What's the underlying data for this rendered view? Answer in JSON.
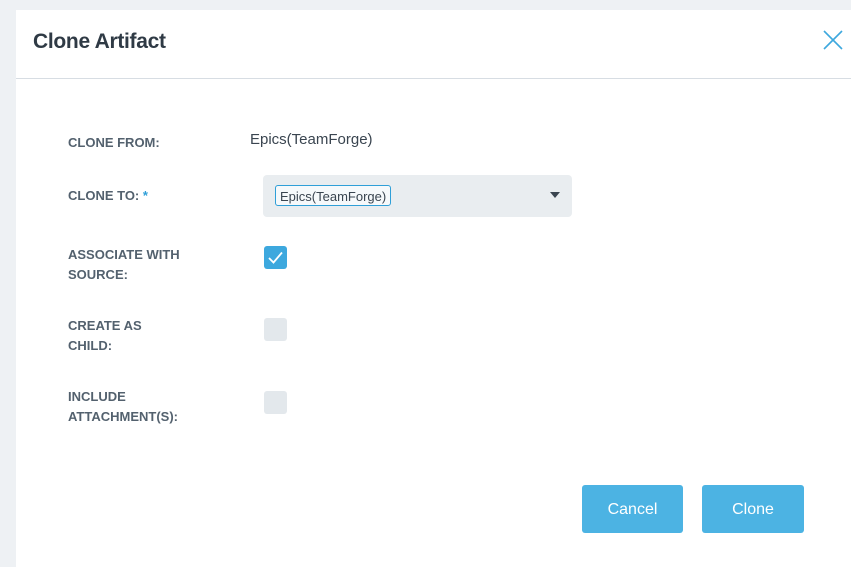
{
  "dialog": {
    "title": "Clone Artifact",
    "close_icon": "close-icon"
  },
  "form": {
    "clone_from": {
      "label": "CLONE FROM:",
      "value": "Epics(TeamForge)"
    },
    "clone_to": {
      "label": "CLONE TO:",
      "required_marker": "*",
      "selected_value": "Epics(TeamForge)",
      "caret_icon": "caret-down-icon"
    },
    "associate_with_source": {
      "label_line1": "ASSOCIATE WITH",
      "label_line2": "SOURCE:",
      "checked": true
    },
    "create_as_child": {
      "label_line1": "CREATE AS",
      "label_line2": "CHILD:",
      "checked": false
    },
    "include_attachments": {
      "label_line1": "INCLUDE",
      "label_line2": "ATTACHMENT(S):",
      "checked": false
    }
  },
  "buttons": {
    "cancel_label": "Cancel",
    "clone_label": "Clone"
  },
  "colors": {
    "accent": "#4cb3e3",
    "checkbox_checked": "#3da8de",
    "checkbox_unchecked": "#e3e8ec",
    "title_text": "#2f3a45",
    "label_text": "#53616e"
  }
}
